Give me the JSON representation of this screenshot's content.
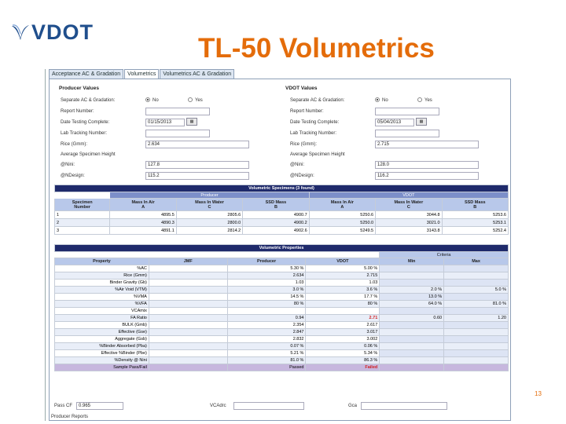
{
  "logo": {
    "text": "VDOT"
  },
  "slide": {
    "title": "TL-50 Volumetrics",
    "page_number": "13"
  },
  "tabs": [
    {
      "label": "Acceptance AC & Gradation",
      "active": false
    },
    {
      "label": "Volumetrics",
      "active": true
    },
    {
      "label": "Volumetrics AC & Gradation",
      "active": false
    }
  ],
  "producer": {
    "heading": "Producer Values",
    "separate_label": "Separate AC & Gradation:",
    "opt_no": "No",
    "opt_yes": "Yes",
    "report_label": "Report Number:",
    "date_label": "Date Testing Complete:",
    "date_value": "01/15/2013",
    "lab_label": "Lab Tracking Number:",
    "rice_label": "Rice (Gmm):",
    "rice_value": "2.634",
    "avg_label": "Average Specimen Height",
    "nini_label": "@Nini:",
    "nini_value": "127.8",
    "ndes_label": "@NDesign:",
    "ndes_value": "115.2"
  },
  "vdot": {
    "heading": "VDOT Values",
    "separate_label": "Separate AC & Gradation:",
    "opt_no": "No",
    "opt_yes": "Yes",
    "report_label": "Report Number:",
    "date_label": "Date Testing Complete:",
    "date_value": "05/04/2013",
    "lab_label": "Lab Tracking Number:",
    "rice_label": "Rice (Gmm):",
    "rice_value": "2.715",
    "avg_label": "Average Specimen Height",
    "nini_label": "@Nini:",
    "nini_value": "128.0",
    "ndes_label": "@NDesign:",
    "ndes_value": "116.2"
  },
  "specimens": {
    "caption": "Volumetric Specimens (3 found)",
    "group_producer": "Producer",
    "group_vdot": "VDOT",
    "headers": [
      [
        "Specimen",
        "Number"
      ],
      [
        "Mass In Air",
        "A"
      ],
      [
        "Mass In Water",
        "C"
      ],
      [
        "SSD Mass",
        "B"
      ],
      [
        "Mass In Air",
        "A"
      ],
      [
        "Mass In Water",
        "C"
      ],
      [
        "SSD Mass",
        "B"
      ]
    ],
    "rows": [
      [
        "1",
        "4895.5",
        "2805.6",
        "4900.7",
        "5250.6",
        "3044.8",
        "5253.6"
      ],
      [
        "2",
        "4890.3",
        "2800.0",
        "4900.2",
        "5250.0",
        "3021.0",
        "5253.1"
      ],
      [
        "3",
        "4891.1",
        "2814.2",
        "4902.6",
        "5249.5",
        "3143.8",
        "5252.4"
      ]
    ]
  },
  "properties": {
    "caption": "Volumetric Properties",
    "criteria": "Criteria",
    "headers": [
      "Property",
      "JMF",
      "Producer",
      "VDOT",
      "Min",
      "Max"
    ],
    "rows": [
      {
        "label": "%AC",
        "jmf": "",
        "producer": "5.30 %",
        "vdot": "5.00 %",
        "min": "",
        "max": "",
        "fail": false
      },
      {
        "label": "Rice (Gmm)",
        "jmf": "",
        "producer": "2.634",
        "vdot": "2.715",
        "min": "",
        "max": "",
        "fail": false
      },
      {
        "label": "Binder Gravity (Gb)",
        "jmf": "",
        "producer": "1.03",
        "vdot": "1.03",
        "min": "",
        "max": "",
        "fail": false
      },
      {
        "label": "%Air Void (VTM)",
        "jmf": "",
        "producer": "3.0 %",
        "vdot": "3.6 %",
        "min": "2.0 %",
        "max": "5.0 %",
        "fail": false
      },
      {
        "label": "%VMA",
        "jmf": "",
        "producer": "14.5 %",
        "vdot": "17.7 %",
        "min": "13.0 %",
        "max": "",
        "fail": false
      },
      {
        "label": "%VFA",
        "jmf": "",
        "producer": "80 %",
        "vdot": "80 %",
        "min": "64.0 %",
        "max": "81.0 %",
        "fail": false
      },
      {
        "label": "VCAmix",
        "jmf": "",
        "producer": "",
        "vdot": "",
        "min": "",
        "max": "",
        "fail": false
      },
      {
        "label": "FA Ratio",
        "jmf": "",
        "producer": "0.94",
        "vdot": "2.71",
        "min": "0.60",
        "max": "1.20",
        "fail": true
      },
      {
        "label": "BULK (Gmb)",
        "jmf": "",
        "producer": "2.354",
        "vdot": "2.617",
        "min": "",
        "max": "",
        "fail": false
      },
      {
        "label": "Effective (Gse)",
        "jmf": "",
        "producer": "2.847",
        "vdot": "3.017",
        "min": "",
        "max": "",
        "fail": false
      },
      {
        "label": "Aggregate (Gsb)",
        "jmf": "",
        "producer": "2.832",
        "vdot": "3.002",
        "min": "",
        "max": "",
        "fail": false
      },
      {
        "label": "%Binder Absorbed (Pba)",
        "jmf": "",
        "producer": "0.07 %",
        "vdot": "0.06 %",
        "min": "",
        "max": "",
        "fail": false
      },
      {
        "label": "Effective %Binder (Pbe)",
        "jmf": "",
        "producer": "5.21 %",
        "vdot": "5.34 %",
        "min": "",
        "max": "",
        "fail": false
      },
      {
        "label": "%Density @ Nini",
        "jmf": "",
        "producer": "81.0 %",
        "vdot": "86.3 %",
        "min": "",
        "max": "",
        "fail": false
      },
      {
        "label": "Sample Pass/Fail",
        "jmf": "",
        "producer": "Passed",
        "vdot": "Failed",
        "min": "",
        "max": "",
        "fail": true
      }
    ]
  },
  "bottom": {
    "pass_label": "Pass CF",
    "pass_value": "0.965",
    "vca_label": "VCAdrc",
    "gca_label": "Gca",
    "extra_label": "Producer Reports"
  },
  "colors": {
    "title_orange": "#e46c0a",
    "logo_blue": "#1f4e8c",
    "table_header_navy": "#1f2a6b",
    "fail_red": "#d02020"
  }
}
